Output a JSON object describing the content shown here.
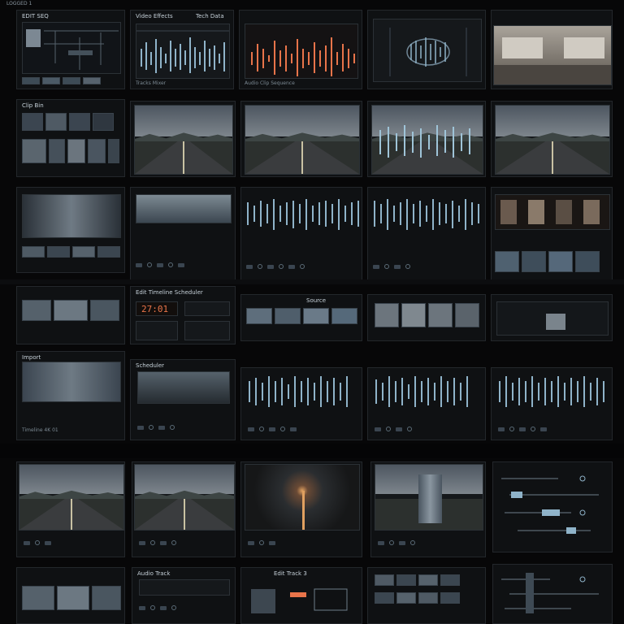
{
  "wall": {
    "top_label": "LOGGED 1",
    "row1": {
      "panel_a": {
        "header": "EDIT SEQ"
      },
      "panel_b": {
        "header": "Video Effects",
        "header2": "Tech Data",
        "footer": "Tracks Mixer"
      },
      "panel_c": {
        "footer": "Audio Clip Sequence"
      }
    },
    "row2": {
      "panel_a": {
        "header": "Clip Bin"
      }
    },
    "row4": {
      "panel_b": {
        "header": "Edit Timeline Scheduler",
        "readout": "27:01"
      },
      "panel_c": {
        "header": "Source"
      }
    },
    "row5": {
      "panel_a": {
        "header": "Import"
      },
      "panel_b": {
        "header": "Scheduler"
      },
      "panel_a_footer": "Timeline 4K 01"
    },
    "row7": {
      "panel_b": {
        "header": "Audio Track"
      },
      "panel_c": {
        "header": "Edit Track 3"
      }
    }
  },
  "colors": {
    "background": "#070708",
    "panel": "#0f1113",
    "accent_orange": "#e8744a",
    "waveform": "#8fb3c9"
  }
}
